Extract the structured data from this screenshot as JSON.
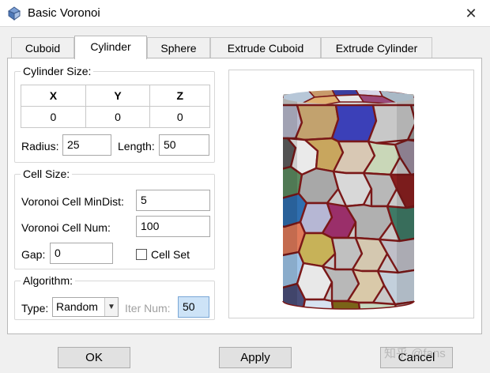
{
  "window": {
    "title": "Basic Voronoi",
    "close_glyph": "✕"
  },
  "tabs": [
    "Cuboid",
    "Cylinder",
    "Sphere",
    "Extrude Cuboid",
    "Extrude Cylinder"
  ],
  "active_tab": "Cylinder",
  "cylinder_size": {
    "title": "Cylinder Size:",
    "headers": [
      "X",
      "Y",
      "Z"
    ],
    "values": [
      "0",
      "0",
      "0"
    ],
    "radius_label": "Radius:",
    "radius_value": "25",
    "length_label": "Length:",
    "length_value": "50"
  },
  "cell_size": {
    "title": "Cell Size:",
    "min_dist_label": "Voronoi Cell MinDist:",
    "min_dist_value": "5",
    "cell_num_label": "Voronoi Cell Num:",
    "cell_num_value": "100",
    "gap_label": "Gap:",
    "gap_value": "0",
    "cell_set_label": "Cell Set",
    "cell_set_checked": false
  },
  "algorithm": {
    "title": "Algorithm:",
    "type_label": "Type:",
    "type_value": "Random",
    "iter_label": "Iter Num:",
    "iter_value": "50"
  },
  "buttons": {
    "ok": "OK",
    "apply": "Apply",
    "cancel": "Cancel"
  },
  "watermark": "知乎 @fans",
  "colors": {
    "cell_border": "#7a1818",
    "iter_highlight": "#cde3f7"
  }
}
